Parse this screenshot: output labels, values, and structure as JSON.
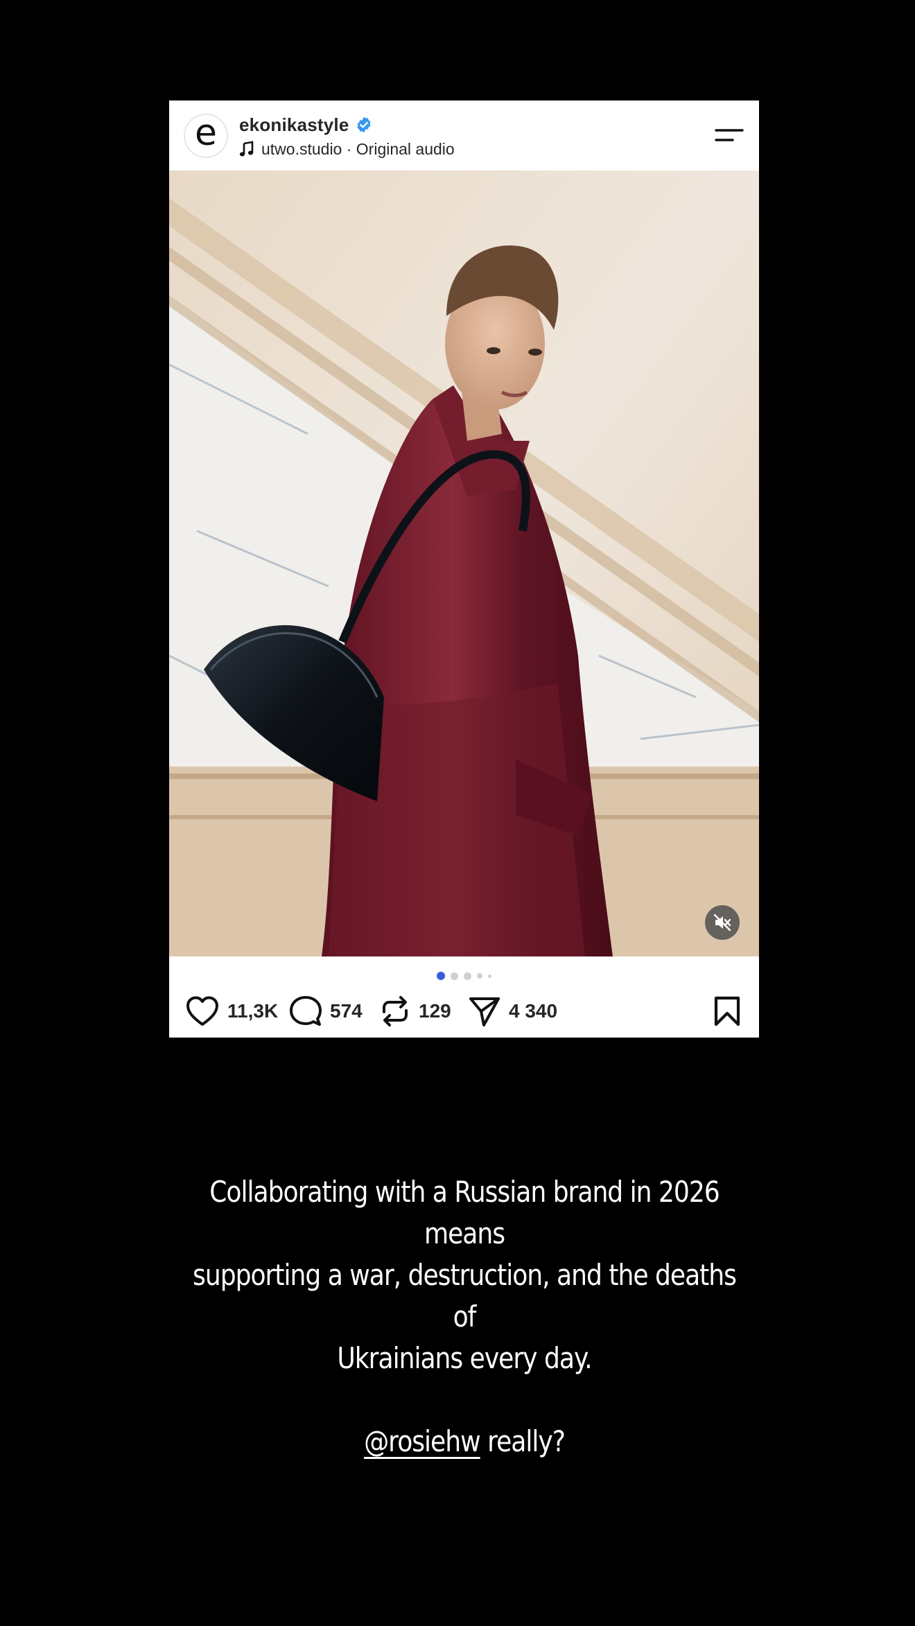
{
  "post": {
    "username": "ekonikastyle",
    "avatar_letter": "e",
    "verified": true,
    "audio": "utwo.studio · Original audio",
    "icons": {
      "verified": "verified-badge-icon",
      "music": "music-note-icon",
      "menu": "menu-lines-icon",
      "mute": "muted-speaker-icon",
      "like": "heart-icon",
      "comment": "comment-bubble-icon",
      "repost": "repost-arrows-icon",
      "share": "send-paper-plane-icon",
      "save": "bookmark-icon"
    },
    "carousel": {
      "total_dots": 5,
      "active_index": 0,
      "active_color": "#3b5bdb"
    },
    "stats": {
      "likes": "11,3K",
      "comments": "574",
      "reposts": "129",
      "shares": "4 340"
    }
  },
  "caption": {
    "line1": "Collaborating with a Russian brand in 2026 means",
    "line2": "supporting a war, destruction, and the deaths of",
    "line3": "Ukrainians every day.",
    "mention": "@rosiehw",
    "question": " really?"
  },
  "colors": {
    "background": "#000000",
    "card": "#ffffff",
    "verified_blue": "#3897f0",
    "coat": "#6b1826",
    "text_dark": "#262626"
  }
}
